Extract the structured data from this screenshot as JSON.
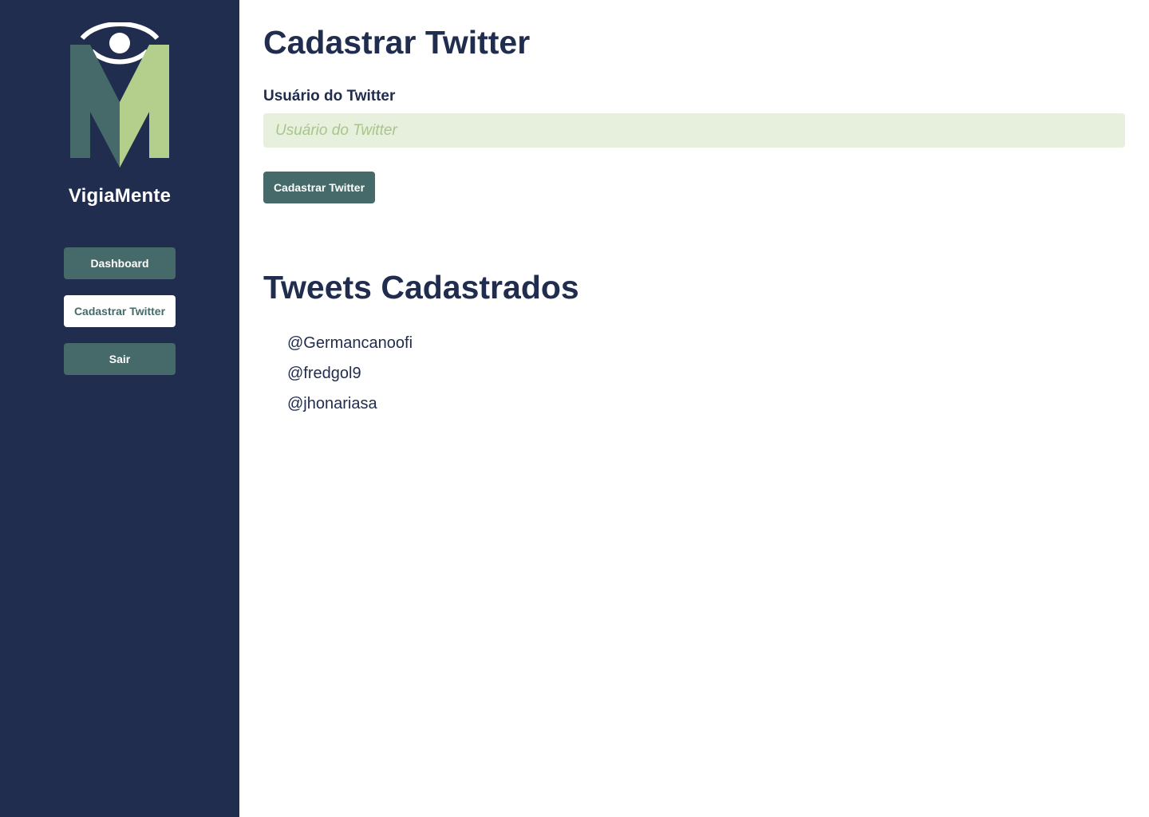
{
  "brand": {
    "name": "VigiaMente"
  },
  "nav": {
    "dashboard": "Dashboard",
    "cadastrar": "Cadastrar Twitter",
    "sair": "Sair"
  },
  "form": {
    "title": "Cadastrar Twitter",
    "label": "Usuário do Twitter",
    "placeholder": "Usuário do Twitter",
    "value": "",
    "submit_label": "Cadastrar Twitter"
  },
  "tweets": {
    "title": "Tweets Cadastrados",
    "items": [
      "@Germancanoofi",
      "@fredgol9",
      "@jhonariasa"
    ]
  },
  "colors": {
    "sidebar": "#212d4e",
    "button": "#456a69",
    "input_bg": "#e7efdd",
    "logo_dark": "#456a69",
    "logo_light": "#b4cf8c"
  },
  "icons": {
    "logo": "eye-m-logo"
  }
}
